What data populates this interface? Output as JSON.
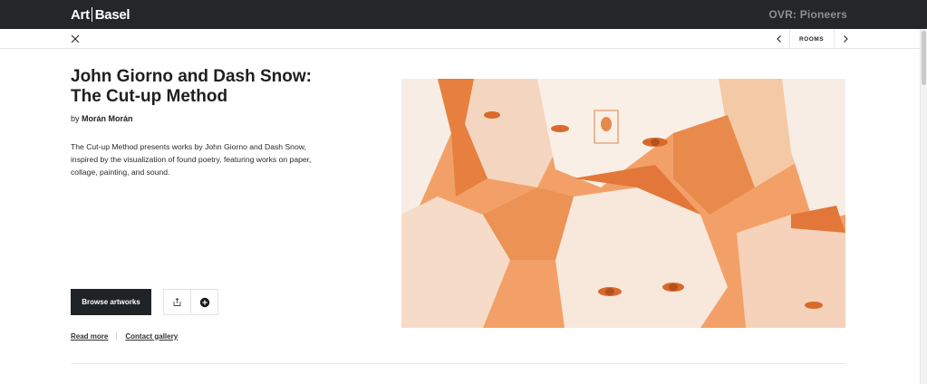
{
  "header": {
    "logo_left": "Art",
    "logo_right": "Basel",
    "show_title": "OVR: Pioneers"
  },
  "nav": {
    "rooms_label": "ROOMS"
  },
  "room": {
    "title_line1": "John Giorno and Dash Snow:",
    "title_line2": "The Cut-up Method",
    "by_prefix": "by",
    "gallery_name": "Morán Morán",
    "description": "The Cut-up Method presents works by John Giorno and Dash Snow, inspired by the visualization of found poetry, featuring works on paper, collage, painting, and sound."
  },
  "actions": {
    "browse_label": "Browse artworks",
    "read_more": "Read more",
    "contact_gallery": "Contact gallery"
  },
  "colors": {
    "topbar": "#23272a",
    "hero_orange": "#f3a068",
    "hero_cream": "#f7ede4"
  },
  "icons": {
    "close": "close-icon",
    "prev": "chevron-left-icon",
    "next": "chevron-right-icon",
    "share": "share-icon",
    "add": "plus-circle-icon"
  }
}
